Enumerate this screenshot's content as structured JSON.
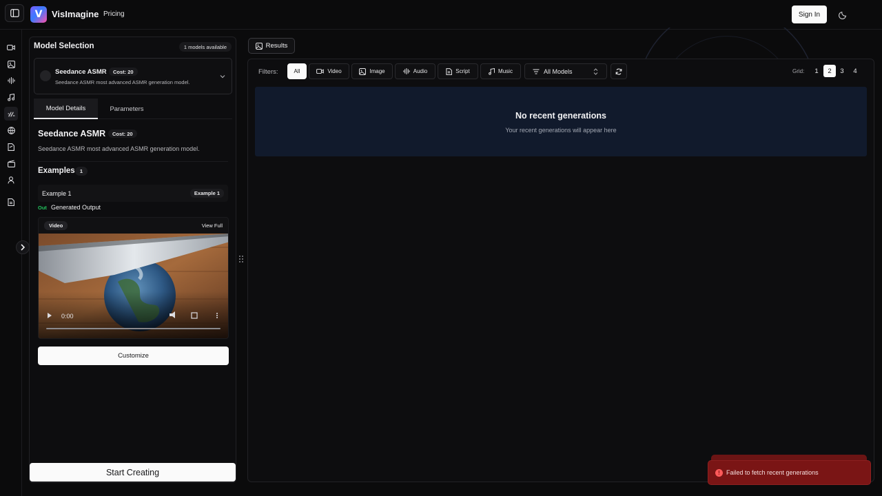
{
  "header": {
    "app_title": "VisImagine",
    "logo_letter": "V",
    "nav": {
      "pricing": "Pricing"
    },
    "sign_in": "Sign In",
    "theme_icon": "moon-icon"
  },
  "rail": {
    "items": [
      {
        "name": "video-icon"
      },
      {
        "name": "image-icon"
      },
      {
        "name": "audio-icon"
      },
      {
        "name": "music-icon"
      },
      {
        "name": "asmr-icon",
        "active": true
      },
      {
        "name": "globe-icon"
      },
      {
        "name": "script-icon"
      },
      {
        "name": "clapperboard-icon"
      },
      {
        "name": "user-icon"
      },
      {
        "name": "document-icon"
      }
    ]
  },
  "model_selection": {
    "title": "Model Selection",
    "available": "1 models available",
    "selected": {
      "name": "Seedance ASMR",
      "cost": "Cost: 20",
      "description": "Seedance ASMR most advanced ASMR generation model."
    },
    "tabs": [
      "Model Details",
      "Parameters"
    ],
    "details": {
      "name": "Seedance ASMR",
      "cost": "Cost: 20",
      "description": "Seedance ASMR most advanced ASMR generation model.",
      "examples_title": "Examples",
      "examples_count": "1",
      "example": {
        "name": "Example 1",
        "tag": "Example 1",
        "out_label": "Out",
        "out_title": "Generated Output",
        "media_type": "Video",
        "view_full": "View Full",
        "time": "0:00"
      }
    },
    "customize": "Customize",
    "start": "Start Creating"
  },
  "results": {
    "tab_label": "Results",
    "filters_label": "Filters:",
    "filters": [
      "All",
      "Video",
      "Image",
      "Audio",
      "Script",
      "Music"
    ],
    "active_filter": "All",
    "models_select": "All Models",
    "grid_label": "Grid:",
    "grid_options": [
      "1",
      "2",
      "3",
      "4"
    ],
    "active_grid": "2",
    "empty_title": "No recent generations",
    "empty_subtitle": "Your recent generations will appear here"
  },
  "toast": {
    "message": "Failed to fetch recent generations"
  },
  "colors": {
    "background": "#0b0b0c",
    "empty_panel": "#111a2c",
    "toast": "#7a1515",
    "out_green": "#22c55e"
  }
}
